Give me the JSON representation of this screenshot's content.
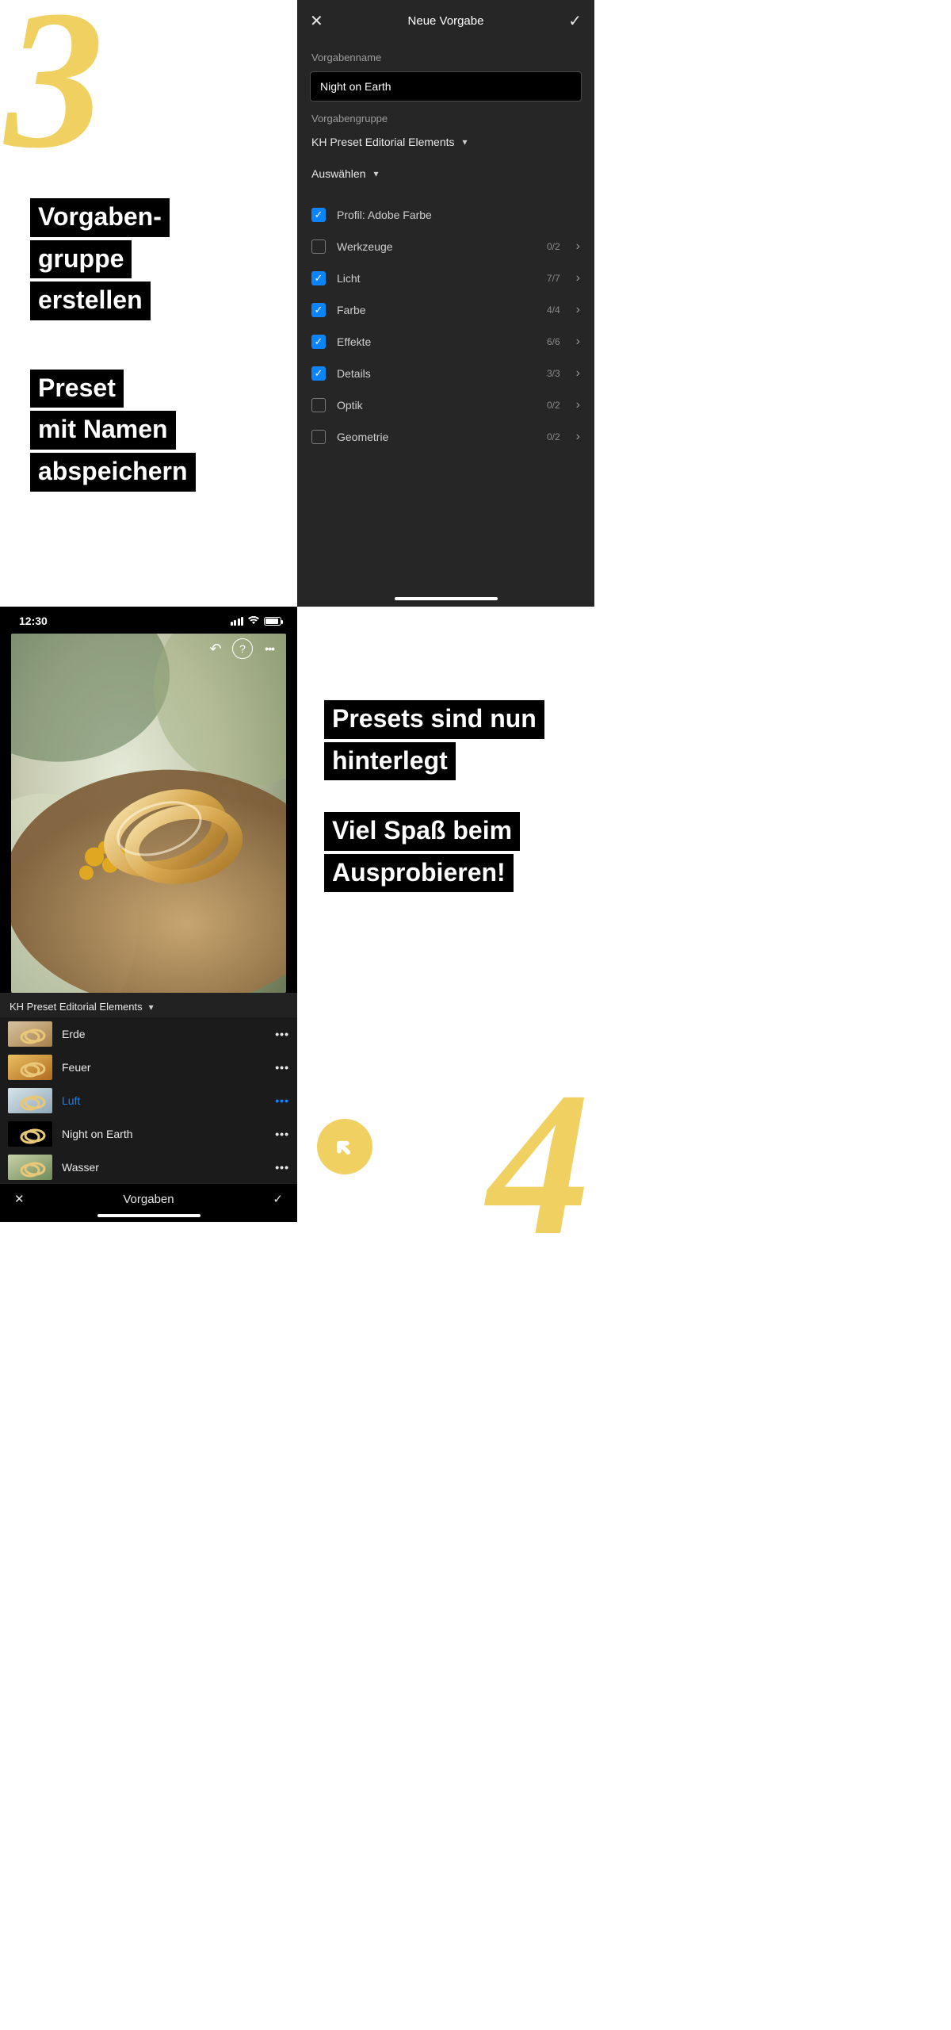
{
  "numbers": {
    "three": "3",
    "four": "4"
  },
  "instructions": {
    "create_group": [
      "Vorgaben-",
      "gruppe",
      "erstellen"
    ],
    "save_preset": [
      "Preset",
      "mit Namen",
      "abspeichern"
    ],
    "stored": [
      "Presets sind nun",
      "hinterlegt"
    ],
    "enjoy": [
      "Viel Spaß beim",
      "Ausprobieren!"
    ]
  },
  "preset_panel": {
    "title": "Neue Vorgabe",
    "name_label": "Vorgabenname",
    "name_value": "Night on Earth",
    "group_label": "Vorgabengruppe",
    "group_value": "KH Preset Editorial Elements",
    "select_label": "Auswählen",
    "settings": [
      {
        "label": "Profil: Adobe Farbe",
        "checked": true,
        "count": "",
        "chevron": false
      },
      {
        "label": "Werkzeuge",
        "checked": false,
        "count": "0/2",
        "chevron": true
      },
      {
        "label": "Licht",
        "checked": true,
        "count": "7/7",
        "chevron": true
      },
      {
        "label": "Farbe",
        "checked": true,
        "count": "4/4",
        "chevron": true
      },
      {
        "label": "Effekte",
        "checked": true,
        "count": "6/6",
        "chevron": true
      },
      {
        "label": "Details",
        "checked": true,
        "count": "3/3",
        "chevron": true
      },
      {
        "label": "Optik",
        "checked": false,
        "count": "0/2",
        "chevron": true
      },
      {
        "label": "Geometrie",
        "checked": false,
        "count": "0/2",
        "chevron": true
      }
    ]
  },
  "phone": {
    "time": "12:30",
    "preset_group": "KH Preset Editorial Elements",
    "presets": [
      {
        "name": "Erde",
        "active": false,
        "tint": "warm"
      },
      {
        "name": "Feuer",
        "active": false,
        "tint": "hot"
      },
      {
        "name": "Luft",
        "active": true,
        "tint": "cool"
      },
      {
        "name": "Night on Earth",
        "active": false,
        "tint": "night"
      },
      {
        "name": "Wasser",
        "active": false,
        "tint": "green"
      }
    ],
    "bottom_bar_title": "Vorgaben"
  }
}
